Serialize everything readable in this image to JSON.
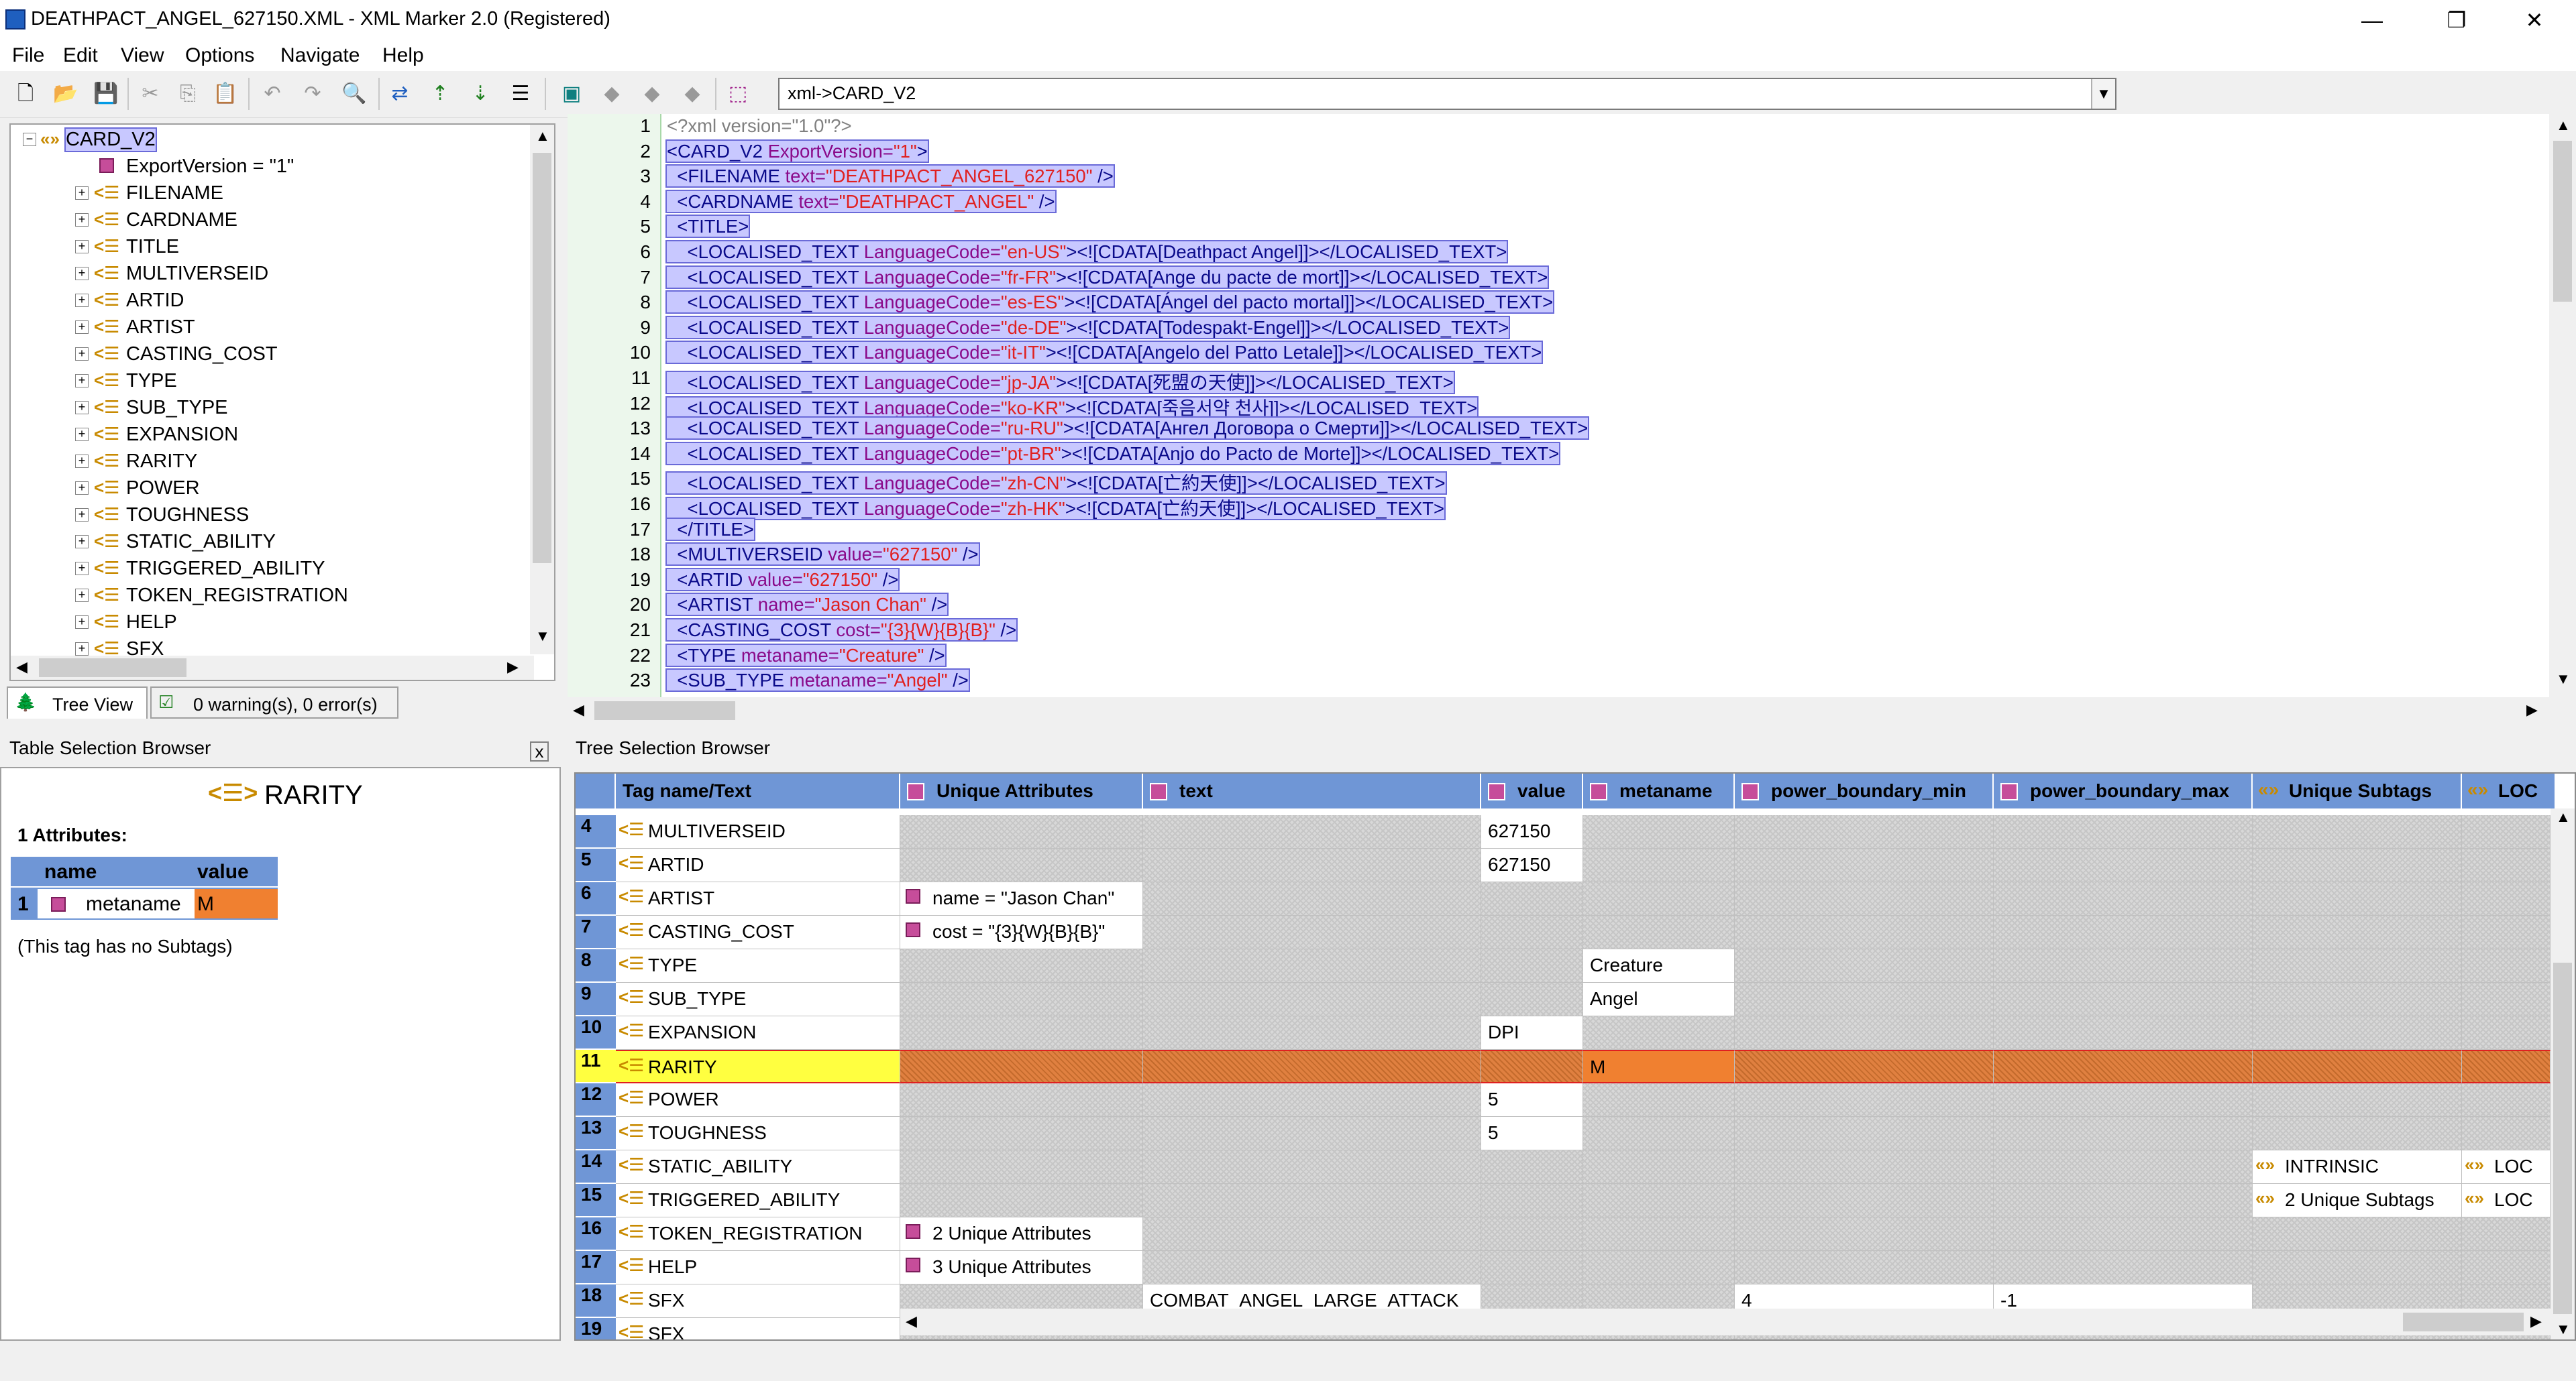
{
  "window": {
    "title": "DEATHPACT_ANGEL_627150.XML - XML Marker 2.0 (Registered)",
    "minimize": "—",
    "maximize": "❐",
    "close": "✕"
  },
  "menu": [
    "File",
    "Edit",
    "View",
    "Options",
    "Navigate",
    "Help"
  ],
  "toolbar": {
    "path_value": "xml->CARD_V2",
    "icons": [
      "new-file-icon",
      "open-folder-icon",
      "save-icon",
      "cut-icon",
      "copy-icon",
      "paste-icon",
      "undo-icon",
      "redo-icon",
      "find-icon",
      "tree-icon",
      "move-up-icon",
      "move-down-icon",
      "list-icon",
      "frame-icon",
      "nav-back-icon",
      "nav-fwd-icon",
      "nav-down-icon",
      "goto-icon"
    ]
  },
  "tree": {
    "root": "CARD_V2",
    "attribute": "ExportVersion = \"1\"",
    "items": [
      "FILENAME",
      "CARDNAME",
      "TITLE",
      "MULTIVERSEID",
      "ARTID",
      "ARTIST",
      "CASTING_COST",
      "TYPE",
      "SUB_TYPE",
      "EXPANSION",
      "RARITY",
      "POWER",
      "TOUGHNESS",
      "STATIC_ABILITY",
      "TRIGGERED_ABILITY",
      "TOKEN_REGISTRATION",
      "HELP",
      "SFX"
    ],
    "tab_tree_view": "Tree View",
    "tab_messages": "0 warning(s), 0 error(s)"
  },
  "editor": {
    "line_numbers": [
      "1",
      "2",
      "3",
      "4",
      "5",
      "6",
      "7",
      "8",
      "9",
      "10",
      "11",
      "12",
      "13",
      "14",
      "15",
      "16",
      "17",
      "18",
      "19",
      "20",
      "21",
      "22",
      "23"
    ],
    "lines": [
      {
        "parts": [
          [
            "pi",
            "<?xml version=\"1.0\"?>"
          ]
        ]
      },
      {
        "sel": true,
        "parts": [
          [
            "tg",
            "<CARD_V2 "
          ],
          [
            "at",
            "ExportVersion="
          ],
          [
            "av",
            "\"1\""
          ],
          [
            "tg",
            ">"
          ]
        ]
      },
      {
        "sel": true,
        "parts": [
          [
            "tg",
            "  <FILENAME "
          ],
          [
            "at",
            "text="
          ],
          [
            "av",
            "\"DEATHPACT_ANGEL_627150\""
          ],
          [
            "tg",
            " />"
          ]
        ]
      },
      {
        "sel": true,
        "parts": [
          [
            "tg",
            "  <CARDNAME "
          ],
          [
            "at",
            "text="
          ],
          [
            "av",
            "\"DEATHPACT_ANGEL\""
          ],
          [
            "tg",
            " />"
          ]
        ]
      },
      {
        "sel": true,
        "parts": [
          [
            "tg",
            "  <TITLE>"
          ]
        ]
      },
      {
        "sel": true,
        "parts": [
          [
            "tg",
            "    <LOCALISED_TEXT "
          ],
          [
            "at",
            "LanguageCode="
          ],
          [
            "av",
            "\"en-US\""
          ],
          [
            "tg",
            "><![CDATA[Deathpact Angel]]></LOCALISED_TEXT>"
          ]
        ]
      },
      {
        "sel": true,
        "parts": [
          [
            "tg",
            "    <LOCALISED_TEXT "
          ],
          [
            "at",
            "LanguageCode="
          ],
          [
            "av",
            "\"fr-FR\""
          ],
          [
            "tg",
            "><![CDATA[Ange du pacte de mort]]></LOCALISED_TEXT>"
          ]
        ]
      },
      {
        "sel": true,
        "parts": [
          [
            "tg",
            "    <LOCALISED_TEXT "
          ],
          [
            "at",
            "LanguageCode="
          ],
          [
            "av",
            "\"es-ES\""
          ],
          [
            "tg",
            "><![CDATA[Ángel del pacto mortal]]></LOCALISED_TEXT>"
          ]
        ]
      },
      {
        "sel": true,
        "parts": [
          [
            "tg",
            "    <LOCALISED_TEXT "
          ],
          [
            "at",
            "LanguageCode="
          ],
          [
            "av",
            "\"de-DE\""
          ],
          [
            "tg",
            "><![CDATA[Todespakt-Engel]]></LOCALISED_TEXT>"
          ]
        ]
      },
      {
        "sel": true,
        "parts": [
          [
            "tg",
            "    <LOCALISED_TEXT "
          ],
          [
            "at",
            "LanguageCode="
          ],
          [
            "av",
            "\"it-IT\""
          ],
          [
            "tg",
            "><![CDATA[Angelo del Patto Letale]]></LOCALISED_TEXT>"
          ]
        ]
      },
      {
        "sel": true,
        "parts": [
          [
            "tg",
            "    <LOCALISED_TEXT "
          ],
          [
            "at",
            "LanguageCode="
          ],
          [
            "av",
            "\"jp-JA\""
          ],
          [
            "tg",
            "><![CDATA[死盟の天使]]></LOCALISED_TEXT>"
          ]
        ]
      },
      {
        "sel": true,
        "parts": [
          [
            "tg",
            "    <LOCALISED_TEXT "
          ],
          [
            "at",
            "LanguageCode="
          ],
          [
            "av",
            "\"ko-KR\""
          ],
          [
            "tg",
            "><![CDATA[죽음서약 천사]]></LOCALISED_TEXT>"
          ]
        ]
      },
      {
        "sel": true,
        "parts": [
          [
            "tg",
            "    <LOCALISED_TEXT "
          ],
          [
            "at",
            "LanguageCode="
          ],
          [
            "av",
            "\"ru-RU\""
          ],
          [
            "tg",
            "><![CDATA[Ангел Договора о Смерти]]></LOCALISED_TEXT>"
          ]
        ]
      },
      {
        "sel": true,
        "parts": [
          [
            "tg",
            "    <LOCALISED_TEXT "
          ],
          [
            "at",
            "LanguageCode="
          ],
          [
            "av",
            "\"pt-BR\""
          ],
          [
            "tg",
            "><![CDATA[Anjo do Pacto de Morte]]></LOCALISED_TEXT>"
          ]
        ]
      },
      {
        "sel": true,
        "parts": [
          [
            "tg",
            "    <LOCALISED_TEXT "
          ],
          [
            "at",
            "LanguageCode="
          ],
          [
            "av",
            "\"zh-CN\""
          ],
          [
            "tg",
            "><![CDATA[亡約天使]]></LOCALISED_TEXT>"
          ]
        ]
      },
      {
        "sel": true,
        "parts": [
          [
            "tg",
            "    <LOCALISED_TEXT "
          ],
          [
            "at",
            "LanguageCode="
          ],
          [
            "av",
            "\"zh-HK\""
          ],
          [
            "tg",
            "><![CDATA[亡約天使]]></LOCALISED_TEXT>"
          ]
        ]
      },
      {
        "sel": true,
        "parts": [
          [
            "tg",
            "  </TITLE>"
          ]
        ]
      },
      {
        "sel": true,
        "parts": [
          [
            "tg",
            "  <MULTIVERSEID "
          ],
          [
            "at",
            "value="
          ],
          [
            "av",
            "\"627150\""
          ],
          [
            "tg",
            " />"
          ]
        ]
      },
      {
        "sel": true,
        "parts": [
          [
            "tg",
            "  <ARTID "
          ],
          [
            "at",
            "value="
          ],
          [
            "av",
            "\"627150\""
          ],
          [
            "tg",
            " />"
          ]
        ]
      },
      {
        "sel": true,
        "parts": [
          [
            "tg",
            "  <ARTIST "
          ],
          [
            "at",
            "name="
          ],
          [
            "av",
            "\"Jason Chan\""
          ],
          [
            "tg",
            " />"
          ]
        ]
      },
      {
        "sel": true,
        "parts": [
          [
            "tg",
            "  <CASTING_COST "
          ],
          [
            "at",
            "cost="
          ],
          [
            "av",
            "\"{3}{W}{B}{B}\""
          ],
          [
            "tg",
            " />"
          ]
        ]
      },
      {
        "sel": true,
        "parts": [
          [
            "tg",
            "  <TYPE "
          ],
          [
            "at",
            "metaname="
          ],
          [
            "av",
            "\"Creature\""
          ],
          [
            "tg",
            " />"
          ]
        ]
      },
      {
        "sel": true,
        "parts": [
          [
            "tg",
            "  <SUB_TYPE "
          ],
          [
            "at",
            "metaname="
          ],
          [
            "av",
            "\"Angel\""
          ],
          [
            "tg",
            " />"
          ]
        ]
      }
    ]
  },
  "table_browser": {
    "header": "Table Selection Browser",
    "close": "x",
    "tag_name": "RARITY",
    "attributes_count": "1 Attributes:",
    "col_name": "name",
    "col_value": "value",
    "row_index": "1",
    "attr_name": "metaname",
    "attr_value": "M",
    "no_subtags": "(This tag has no Subtags)"
  },
  "tree_browser": {
    "header": "Tree Selection Browser",
    "columns": [
      "Tag name/Text",
      "Unique Attributes",
      "text",
      "value",
      "metaname",
      "power_boundary_min",
      "power_boundary_max",
      "Unique Subtags",
      "LOC"
    ],
    "rows": [
      {
        "n": "4",
        "tag": "MULTIVERSEID",
        "value": "627150"
      },
      {
        "n": "5",
        "tag": "ARTID",
        "value": "627150"
      },
      {
        "n": "6",
        "tag": "ARTIST",
        "ua": "name = \"Jason Chan\""
      },
      {
        "n": "7",
        "tag": "CASTING_COST",
        "ua": "cost = \"{3}{W}{B}{B}\""
      },
      {
        "n": "8",
        "tag": "TYPE",
        "metaname": "Creature"
      },
      {
        "n": "9",
        "tag": "SUB_TYPE",
        "metaname": "Angel"
      },
      {
        "n": "10",
        "tag": "EXPANSION",
        "value": "DPI"
      },
      {
        "n": "11",
        "tag": "RARITY",
        "metaname": "M",
        "selected": true
      },
      {
        "n": "12",
        "tag": "POWER",
        "value": "5"
      },
      {
        "n": "13",
        "tag": "TOUGHNESS",
        "value": "5"
      },
      {
        "n": "14",
        "tag": "STATIC_ABILITY",
        "us": "INTRINSIC",
        "loc": "LOC"
      },
      {
        "n": "15",
        "tag": "TRIGGERED_ABILITY",
        "us": "2 Unique Subtags",
        "loc": "LOC"
      },
      {
        "n": "16",
        "tag": "TOKEN_REGISTRATION",
        "ua": "2 Unique Attributes"
      },
      {
        "n": "17",
        "tag": "HELP",
        "ua": "3 Unique Attributes"
      },
      {
        "n": "18",
        "tag": "SFX",
        "text": "COMBAT_ANGEL_LARGE_ATTACK",
        "pmin": "4",
        "pmax": "-1"
      },
      {
        "n": "19",
        "tag": "SFX"
      }
    ]
  },
  "colors": {
    "selection": "#c8c8ff",
    "grid_header": "#6f96d6",
    "highlight_row": "#ffff40",
    "orange_cell": "#f08030"
  }
}
